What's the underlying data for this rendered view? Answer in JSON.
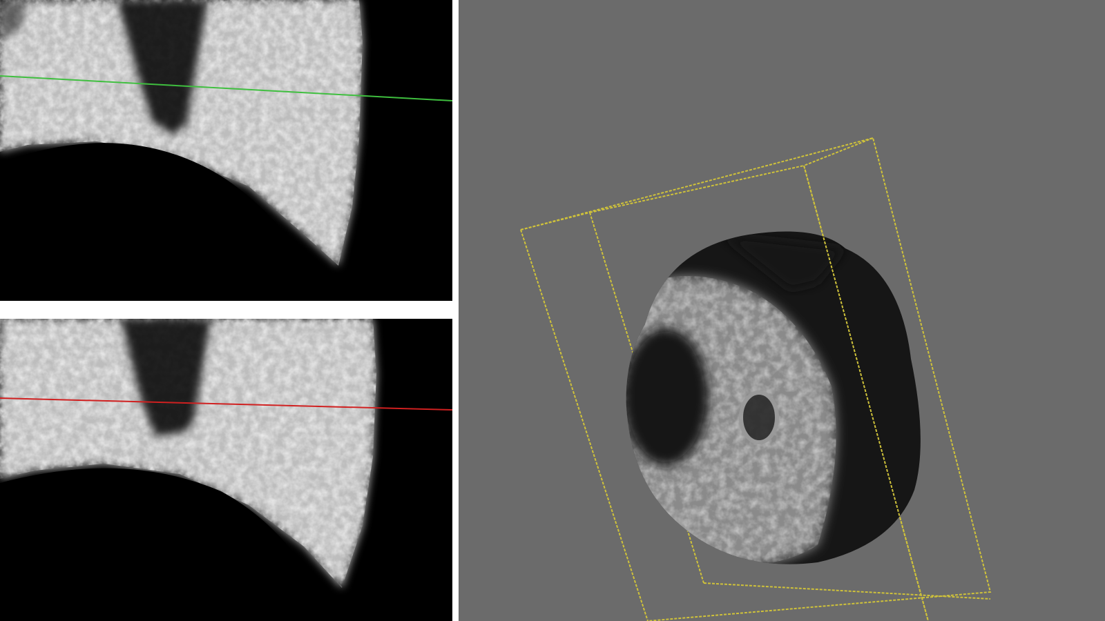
{
  "views": [
    {
      "id": "top",
      "kind": "sagittal-slice",
      "background": "#000000",
      "cursor_color": "#3fbf3f"
    },
    {
      "id": "bottom",
      "kind": "coronal-slice",
      "background": "#000000",
      "cursor_color": "#d02020"
    },
    {
      "id": "volume",
      "kind": "3d-render",
      "background": "#6b6b6b",
      "bounding_box_color": "#cfc23a"
    }
  ],
  "colors": {
    "gutter": "#ffffff",
    "tissue": "#d8d8d8",
    "volume_surface": "#9a9a9a",
    "cyst": "#1a1a1a"
  }
}
